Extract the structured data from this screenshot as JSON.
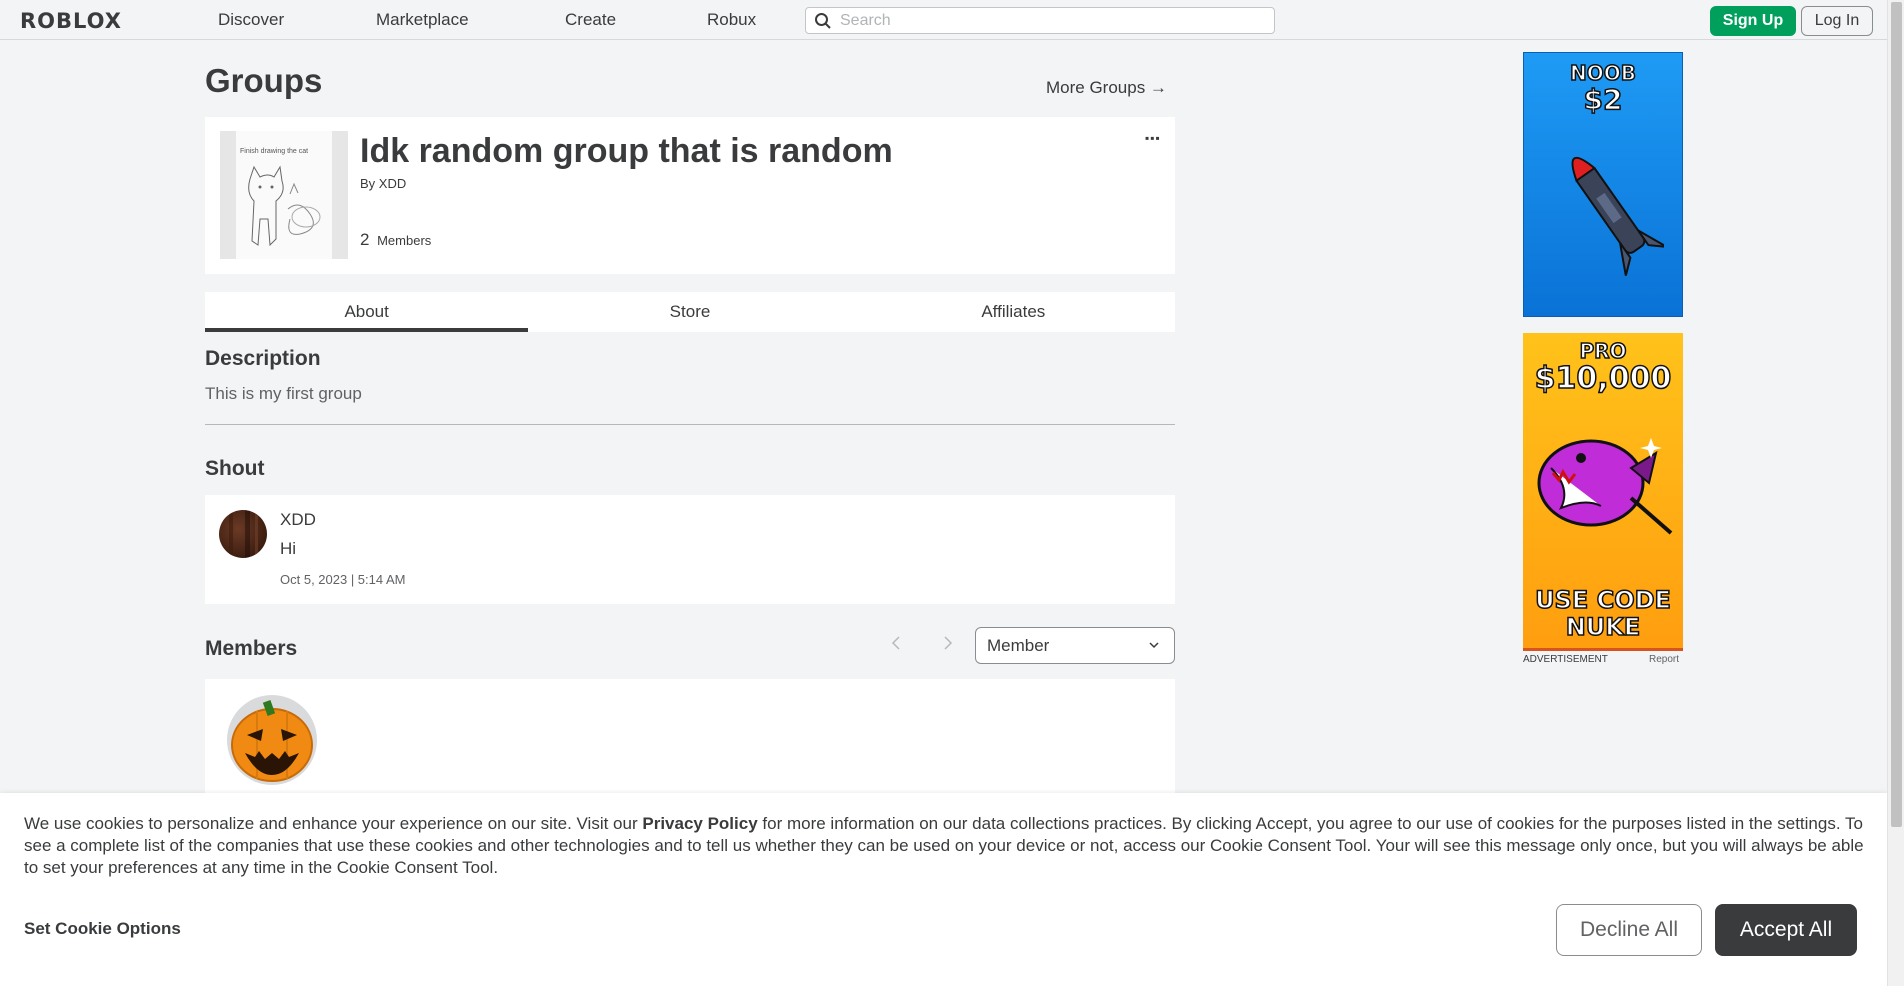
{
  "nav": {
    "logo": "ROBLOX",
    "links": [
      "Discover",
      "Marketplace",
      "Create",
      "Robux"
    ],
    "search_placeholder": "Search",
    "signup_label": "Sign Up",
    "login_label": "Log In"
  },
  "page": {
    "title": "Groups",
    "more_groups": "More Groups →"
  },
  "group": {
    "name": "Idk random group that is random",
    "by_prefix": "By",
    "owner": "XDD",
    "member_count": "2",
    "member_label": "Members",
    "thumb_caption": "Finish drawing the cat",
    "more_menu": "▪▪▪"
  },
  "tabs": [
    "About",
    "Store",
    "Affiliates"
  ],
  "about": {
    "description_heading": "Description",
    "description_text": "This is my first group",
    "shout_heading": "Shout",
    "shout": {
      "user": "XDD",
      "message": "Hi",
      "timestamp": "Oct 5, 2023 | 5:14 AM"
    },
    "members_heading": "Members",
    "role_selected": "Member"
  },
  "ads": {
    "ad1_top": "NOOB",
    "ad1_price": "$2",
    "ad2_top": "PRO",
    "ad2_price": "$10,000",
    "ad2_line1": "USE CODE",
    "ad2_line2": "NUKE",
    "label": "ADVERTISEMENT",
    "report": "Report"
  },
  "cookie": {
    "text_before": "We use cookies to personalize and enhance your experience on our site. Visit our ",
    "policy_link": "Privacy Policy",
    "text_after": " for more information on our data collections practices. By clicking Accept, you agree to our use of cookies for the purposes listed in the settings. To see a complete list of the companies that use these cookies and other technologies and to tell us whether they can be used on your device or not, access our Cookie Consent Tool. Your will see this message only once, but you will always be able to set your preferences at any time in the Cookie Consent Tool.",
    "set_options": "Set Cookie Options",
    "decline": "Decline All",
    "accept": "Accept All"
  }
}
